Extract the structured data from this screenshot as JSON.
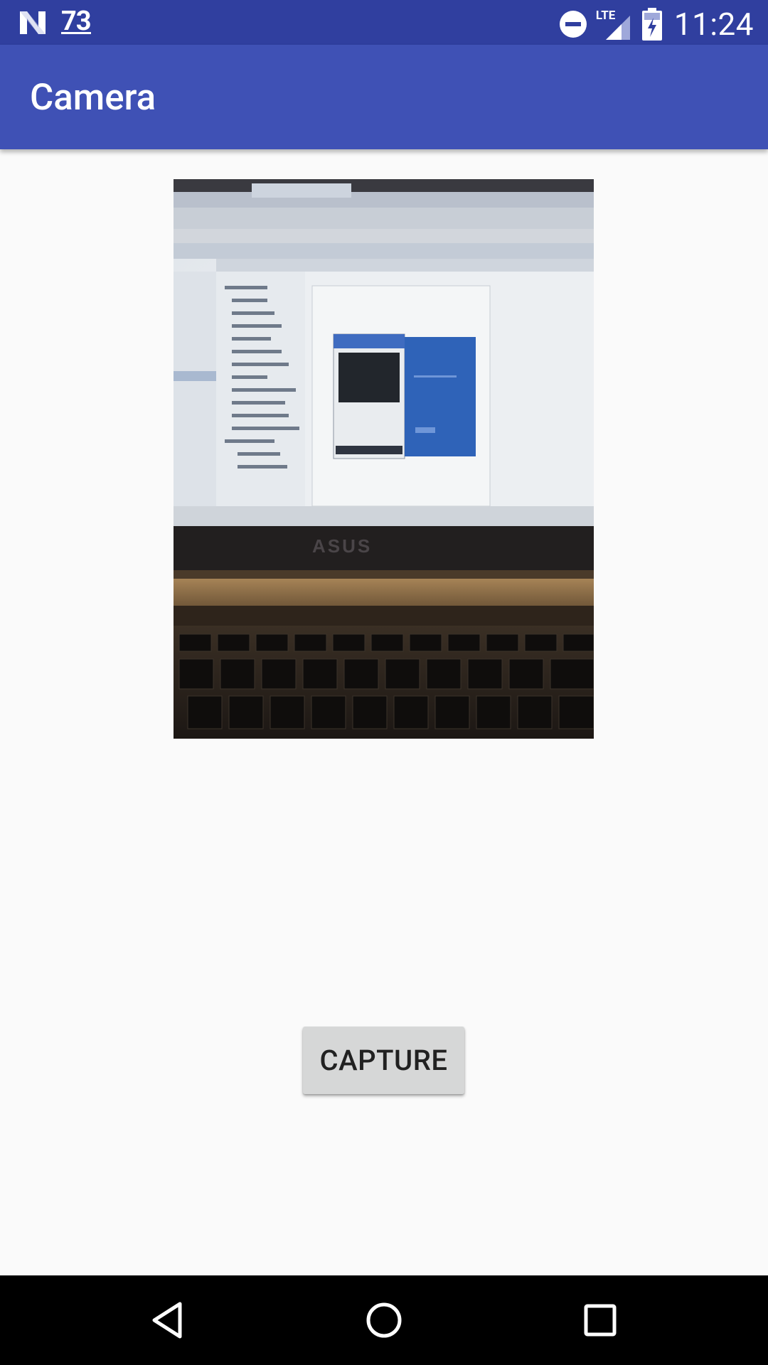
{
  "status_bar": {
    "notification_count": "73",
    "network_type": "LTE",
    "time": "11:24",
    "icons": [
      "notification-n-icon",
      "do-not-disturb-icon",
      "signal-icon",
      "battery-charging-icon"
    ]
  },
  "app_bar": {
    "title": "Camera"
  },
  "photo": {
    "description_hidden": "",
    "laptop_brand": "ASUS"
  },
  "capture_button": {
    "label": "CAPTURE"
  },
  "nav_bar": {
    "icons": [
      "back-icon",
      "home-icon",
      "recents-icon"
    ]
  },
  "colors": {
    "status_bar": "#303f9f",
    "app_bar": "#3f51b5",
    "background": "#fafafa",
    "button": "#d6d7d7"
  }
}
